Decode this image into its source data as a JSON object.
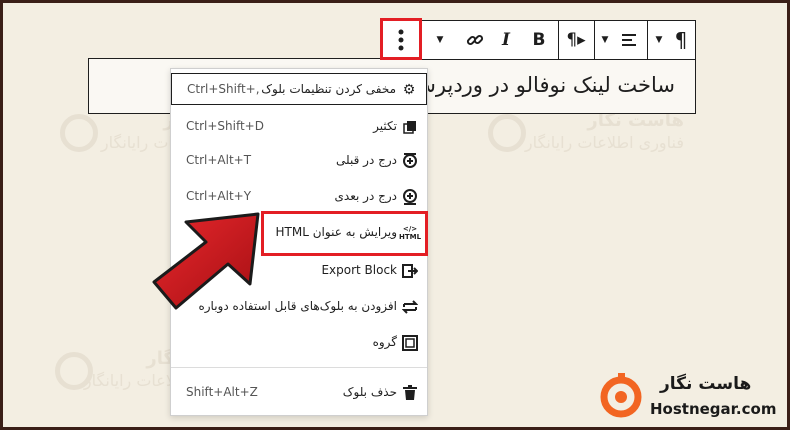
{
  "watermark": {
    "line1": "هاست نگار",
    "line2": "فناوری اطلاعات رایانگار"
  },
  "toolbar": {
    "more_icon": "vertical-ellipsis-icon",
    "buttons": [
      "link-icon",
      "italic-icon",
      "bold-icon",
      "paragraph-rtl-icon",
      "align-icon",
      "paragraph-icon"
    ]
  },
  "block": {
    "text": "ساخت لینک نوفالو در وردپرس"
  },
  "menu": {
    "items": [
      {
        "label": "مخفی کردن تنظیمات بلوک",
        "shortcut": "Ctrl+Shift+,",
        "icon": "gear-icon"
      },
      {
        "label": "تکثیر",
        "shortcut": "Ctrl+Shift+D",
        "icon": "duplicate-icon"
      },
      {
        "label": "درج در قبلی",
        "shortcut": "Ctrl+Alt+T",
        "icon": "insert-before-icon"
      },
      {
        "label": "درج در بعدی",
        "shortcut": "Ctrl+Alt+Y",
        "icon": "insert-after-icon"
      },
      {
        "label": "ویرایش به عنوان HTML",
        "shortcut": "",
        "icon": "html-icon"
      },
      {
        "label": "Export Block",
        "shortcut": "",
        "icon": "export-icon"
      },
      {
        "label": "افزودن به بلوک‌های قابل استفاده دوباره",
        "shortcut": "",
        "icon": "reusable-icon"
      },
      {
        "label": "گروه",
        "shortcut": "",
        "icon": "group-icon"
      },
      {
        "label": "حذف بلوک",
        "shortcut": "Shift+Alt+Z",
        "icon": "trash-icon"
      }
    ]
  },
  "logo": {
    "name_fa": "هاست نگار",
    "name_en": "Hostnegar.com"
  },
  "colors": {
    "highlight": "#e31e24",
    "arrow": "#d0161b",
    "logo_orange": "#f26522"
  }
}
